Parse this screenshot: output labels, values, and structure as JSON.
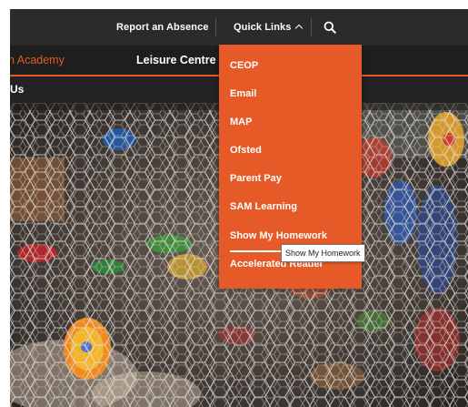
{
  "utility_bar": {
    "report_absence": "Report an Absence",
    "quick_links": "Quick Links"
  },
  "main_nav": {
    "items": [
      {
        "label": "h Academy",
        "color": "#e55a27"
      },
      {
        "label": "Leisure Centre",
        "color": "#ffffff"
      }
    ]
  },
  "sub_nav": {
    "label": "Us"
  },
  "quick_links_menu": {
    "items": [
      {
        "label": "CEOP"
      },
      {
        "label": "Email"
      },
      {
        "label": "MAP"
      },
      {
        "label": "Ofsted"
      },
      {
        "label": "Parent Pay"
      },
      {
        "label": "SAM Learning"
      },
      {
        "label": "Show My Homework"
      },
      {
        "label": "Accelerated Reader"
      }
    ],
    "hovered_index": 6
  },
  "tooltip": {
    "text": "Show My Homework"
  },
  "colors": {
    "accent": "#e55a27",
    "bar_dark": "#2b2b2b",
    "nav_dark": "#1e1e1e"
  }
}
